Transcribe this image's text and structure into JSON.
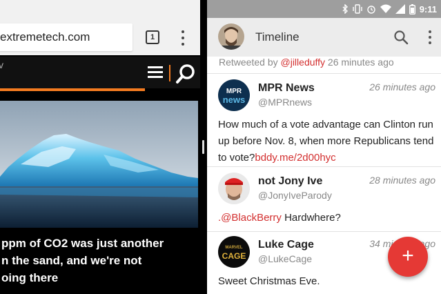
{
  "browser": {
    "url": "extremetech.com",
    "tab_count": "1",
    "site_chevron": "v",
    "headline_lines": [
      "ppm of CO2 was just another",
      "n the sand, and we're not",
      "oing there"
    ],
    "colors": {
      "accent": "#f47b20"
    }
  },
  "status_bar": {
    "time": "9:11"
  },
  "timeline": {
    "title": "Timeline",
    "retweet_prefix": "Retweeted by ",
    "retweet_handle": "@jilleduffy",
    "retweet_time": " 26 minutes ago",
    "tweets": [
      {
        "name": "MPR News",
        "handle": "@MPRnews",
        "time": "26 minutes ago",
        "text": "How much of a vote advantage can Clinton run up before Nov. 8, when more Republicans tend to vote?",
        "link": "bddy.me/2d00hyc",
        "avatar_text": "MPR news"
      },
      {
        "name": "not Jony Ive",
        "handle": "@JonyIveParody",
        "time": "28 minutes ago",
        "prefix": ".",
        "mention": "@BlackBerry",
        "text": " Hardwhere?"
      },
      {
        "name": "Luke Cage",
        "handle": "@LukeCage",
        "time": "34 minutes ago",
        "text": "Sweet Christmas Eve.",
        "avatar_text": "CAGE"
      }
    ],
    "fab_label": "+",
    "colors": {
      "link": "#d32f2f",
      "fab": "#e53935"
    }
  }
}
